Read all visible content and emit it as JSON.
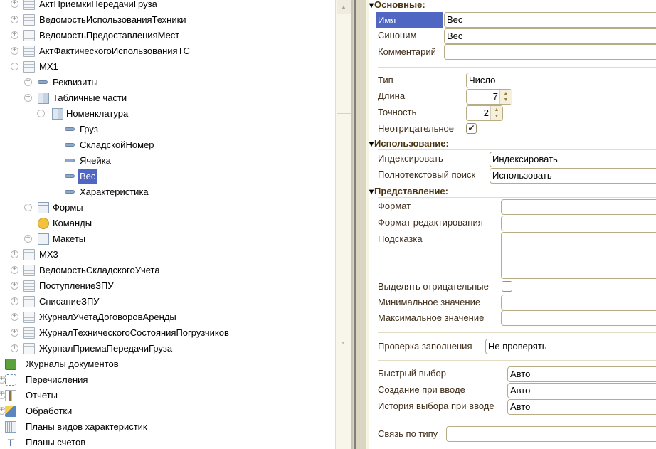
{
  "tree": [
    {
      "label": "АктПриемкиПередачиГруза",
      "level": 1,
      "exp": "+",
      "icon": "doc"
    },
    {
      "label": "ВедомостьИспользованияТехники",
      "level": 1,
      "exp": "+",
      "icon": "doc"
    },
    {
      "label": "ВедомостьПредоставленияМест",
      "level": 1,
      "exp": "+",
      "icon": "doc"
    },
    {
      "label": "АктФактическогоИспользованияТС",
      "level": 1,
      "exp": "+",
      "icon": "doc"
    },
    {
      "label": "МХ1",
      "level": 1,
      "exp": "-",
      "icon": "doc"
    },
    {
      "label": "Реквизиты",
      "level": 2,
      "exp": "+",
      "icon": "attr"
    },
    {
      "label": "Табличные части",
      "level": 2,
      "exp": "-",
      "icon": "tab"
    },
    {
      "label": "Номенклатура",
      "level": 3,
      "exp": "-",
      "icon": "tab"
    },
    {
      "label": "Груз",
      "level": 4,
      "exp": "",
      "icon": "attr"
    },
    {
      "label": "СкладскойНомер",
      "level": 4,
      "exp": "",
      "icon": "attr"
    },
    {
      "label": "Ячейка",
      "level": 4,
      "exp": "",
      "icon": "attr"
    },
    {
      "label": "Вес",
      "level": 4,
      "exp": "",
      "icon": "attr",
      "selected": true
    },
    {
      "label": "Характеристика",
      "level": 4,
      "exp": "",
      "icon": "attr"
    },
    {
      "label": "Формы",
      "level": 2,
      "exp": "+",
      "icon": "form"
    },
    {
      "label": "Команды",
      "level": 2,
      "exp": "",
      "icon": "cmd"
    },
    {
      "label": "Макеты",
      "level": 2,
      "exp": "+",
      "icon": "mak"
    },
    {
      "label": "МХ3",
      "level": 1,
      "exp": "+",
      "icon": "doc"
    },
    {
      "label": "ВедомостьСкладскогоУчета",
      "level": 1,
      "exp": "+",
      "icon": "doc"
    },
    {
      "label": "ПоступлениеЗПУ",
      "level": 1,
      "exp": "+",
      "icon": "doc"
    },
    {
      "label": "СписаниеЗПУ",
      "level": 1,
      "exp": "+",
      "icon": "doc"
    },
    {
      "label": "ЖурналУчетаДоговоровАренды",
      "level": 1,
      "exp": "+",
      "icon": "doc"
    },
    {
      "label": "ЖурналТехническогоСостоянияПогрузчиков",
      "level": 1,
      "exp": "+",
      "icon": "doc"
    },
    {
      "label": "ЖурналПриемаПередачиГруза",
      "level": 1,
      "exp": "+",
      "icon": "doc"
    },
    {
      "label": "Журналы документов",
      "level": 0,
      "exp": "",
      "icon": "jrn"
    },
    {
      "label": "Перечисления",
      "level": 0,
      "exp": "+",
      "icon": "enm"
    },
    {
      "label": "Отчеты",
      "level": 0,
      "exp": "+",
      "icon": "rep"
    },
    {
      "label": "Обработки",
      "level": 0,
      "exp": "+",
      "icon": "prc"
    },
    {
      "label": "Планы видов характеристик",
      "level": 0,
      "exp": "",
      "icon": "pvh"
    },
    {
      "label": "Планы счетов",
      "level": 0,
      "exp": "",
      "icon": "pls"
    }
  ],
  "props": {
    "sections": {
      "main": "Основные:",
      "usage": "Использование:",
      "presentation": "Представление:"
    },
    "name_label": "Имя",
    "name_value": "Вес",
    "synonym_label": "Синоним",
    "synonym_value": "Вес",
    "comment_label": "Комментарий",
    "comment_value": "",
    "type_label": "Тип",
    "type_value": "Число",
    "length_label": "Длина",
    "length_value": "7",
    "precision_label": "Точность",
    "precision_value": "2",
    "nonneg_label": "Неотрицательное",
    "nonneg_checked": true,
    "index_label": "Индексировать",
    "index_value": "Индексировать",
    "fulltext_label": "Полнотекстовый поиск",
    "fulltext_value": "Использовать",
    "format_label": "Формат",
    "format_value": "",
    "editformat_label": "Формат редактирования",
    "editformat_value": "",
    "tooltip_label": "Подсказка",
    "tooltip_value": "",
    "highlightneg_label": "Выделять отрицательные",
    "highlightneg_checked": false,
    "min_label": "Минимальное значение",
    "min_value": "",
    "max_label": "Максимальное значение",
    "max_value": "",
    "fillcheck_label": "Проверка заполнения",
    "fillcheck_value": "Не проверять",
    "quickchoice_label": "Быстрый выбор",
    "quickchoice_value": "Авто",
    "createoninput_label": "Создание при вводе",
    "createoninput_value": "Авто",
    "choicehistory_label": "История выбора при вводе",
    "choicehistory_value": "Авто",
    "linkbytype_label": "Связь по типу",
    "linkbytype_value": ""
  },
  "icons": {
    "check": "✔",
    "scroll_up": "▲",
    "spin": "▲▼"
  }
}
